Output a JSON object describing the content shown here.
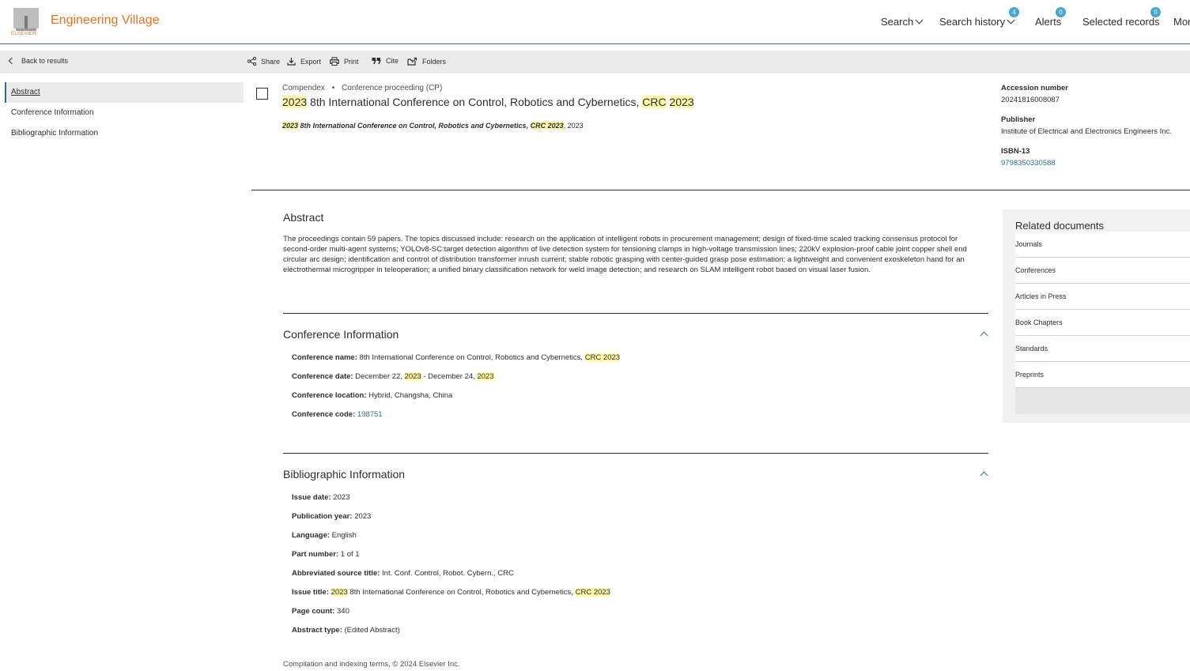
{
  "header": {
    "brand": "Engineering Village",
    "logo_text": "ELSEVIER",
    "nav": [
      {
        "label": "Search",
        "badge": ""
      },
      {
        "label": "Search history",
        "badge": "4"
      },
      {
        "label": "Alerts",
        "badge": "0"
      },
      {
        "label": "Selected records",
        "badge": "0"
      },
      {
        "label": "Mor",
        "badge": ""
      }
    ]
  },
  "toolbar": {
    "back": "Back to results",
    "share": "Share",
    "export": "Export",
    "print": "Print",
    "cite": "Cite",
    "folders": "Folders"
  },
  "leftnav": [
    "Abstract",
    "Conference Information",
    "Bibliographic Information"
  ],
  "record": {
    "database": "Compendex",
    "doc_type": "Conference proceeding (CP)",
    "title_parts": [
      "2023",
      " 8th International Conference on Control, Robotics and Cybernetics, ",
      "CRC",
      " ",
      "2023"
    ],
    "source_parts": [
      "2023",
      " 8th International Conference on Control, Robotics and Cybernetics, ",
      "CRC 2023",
      ", 2023"
    ]
  },
  "meta": {
    "accession_label": "Accession number",
    "accession_value": "20241816008087",
    "publisher_label": "Publisher",
    "publisher_value": "Institute of Electrical and Electronics Engineers Inc.",
    "isbn_label": "ISBN-13",
    "isbn_value": "9798350330588"
  },
  "abstract": {
    "title": "Abstract",
    "text": "The proceedings contain 59 papers. The topics discussed include: research on the application of intelligent robots in procurement management; design of fixed-time scaled tracking consensus protocol for second-order multi-agent systems; YOLOv8-SC:target detection algorithm of live detection system for tensioning clamps in high-voltage transmission lines; 220kV explosion-proof cable joint copper shell end circular arc design; identification and control of distribution transformer inrush current; stable robotic grasping with center-guided grasp pose estimation; a lightweight and convenient exoskeleton hand for an electrothermal microgripper in teleoperation; a unified binary classification network for weld image detection; and research on SLAM intelligent robot based on visual laser fusion."
  },
  "conference": {
    "title": "Conference Information",
    "name_label": "Conference name:",
    "name_value": "8th International Conference on Control, Robotics and Cybernetics,",
    "name_hl": "CRC 2023",
    "date_label": "Conference date:",
    "date_a": "December 22,",
    "date_hl1": "2023",
    "date_b": "- December 24,",
    "date_hl2": "2023",
    "location_label": "Conference location:",
    "location_value": "Hybrid, Changsha, China",
    "code_label": "Conference code:",
    "code_value": "198751"
  },
  "biblio": {
    "title": "Bibliographic Information",
    "issue_date_label": "Issue date:",
    "issue_date_value": "2023",
    "pub_year_label": "Publication year:",
    "pub_year_value": "2023",
    "language_label": "Language:",
    "language_value": "English",
    "part_label": "Part number:",
    "part_value": "1 of 1",
    "abbr_label": "Abbreviated source title:",
    "abbr_value": "Int. Conf. Control, Robot. Cybern., CRC",
    "issue_title_label": "Issue title:",
    "issue_title_hl1": "2023",
    "issue_title_mid": "8th International Conference on Control, Robotics and Cybernetics,",
    "issue_title_hl2": "CRC",
    "issue_title_hl3": "2023",
    "page_count_label": "Page count:",
    "page_count_value": "340",
    "abstract_type_label": "Abstract type:",
    "abstract_type_value": "(Edited Abstract)"
  },
  "footnote": "Compilation and indexing terms, © 2024 Elsevier Inc.",
  "related": {
    "title": "Related documents",
    "items": [
      "Journals",
      "Conferences",
      "Articles in Press",
      "Book Chapters",
      "Standards",
      "Preprints"
    ]
  },
  "colors": {
    "accent": "#e9711c",
    "link": "#2f6e8a",
    "highlight": "#fff7a8",
    "badge": "#44a6d3"
  }
}
